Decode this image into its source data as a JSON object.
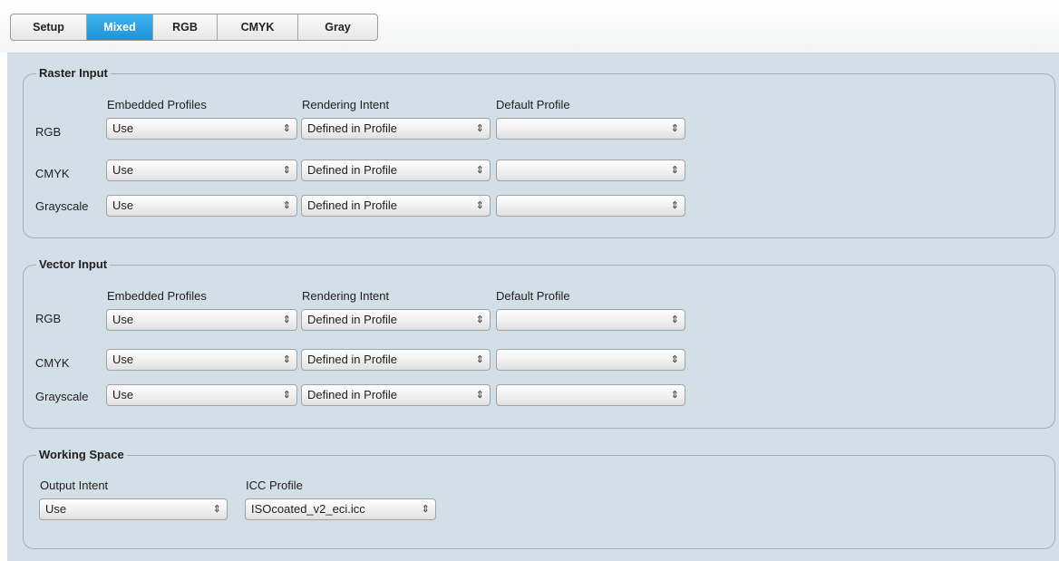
{
  "tabs": [
    {
      "label": "Setup",
      "active": false
    },
    {
      "label": "Mixed",
      "active": true
    },
    {
      "label": "RGB",
      "active": false
    },
    {
      "label": "CMYK",
      "active": false
    },
    {
      "label": "Gray",
      "active": false
    }
  ],
  "raster": {
    "title": "Raster Input",
    "headers": {
      "embedded": "Embedded Profiles",
      "intent": "Rendering Intent",
      "default": "Default Profile"
    },
    "rows": [
      {
        "label": "RGB",
        "embedded": "Use",
        "intent": "Defined in Profile",
        "default": ""
      },
      {
        "label": "CMYK",
        "embedded": "Use",
        "intent": "Defined in Profile",
        "default": ""
      },
      {
        "label": "Grayscale",
        "embedded": "Use",
        "intent": "Defined in Profile",
        "default": ""
      }
    ]
  },
  "vector": {
    "title": "Vector Input",
    "headers": {
      "embedded": "Embedded Profiles",
      "intent": "Rendering Intent",
      "default": "Default Profile"
    },
    "rows": [
      {
        "label": "RGB",
        "embedded": "Use",
        "intent": "Defined in Profile",
        "default": ""
      },
      {
        "label": "CMYK",
        "embedded": "Use",
        "intent": "Defined in Profile",
        "default": ""
      },
      {
        "label": "Grayscale",
        "embedded": "Use",
        "intent": "Defined in Profile",
        "default": ""
      }
    ]
  },
  "working": {
    "title": "Working Space",
    "output_intent_label": "Output Intent",
    "output_intent_value": "Use",
    "icc_label": "ICC Profile",
    "icc_value": "ISOcoated_v2_eci.icc"
  },
  "select_arrow_glyph": "⇕",
  "colors": {
    "accent": "#1c93d6",
    "panel_bg": "#d3dfe7",
    "group_border": "#a6aeb4"
  }
}
